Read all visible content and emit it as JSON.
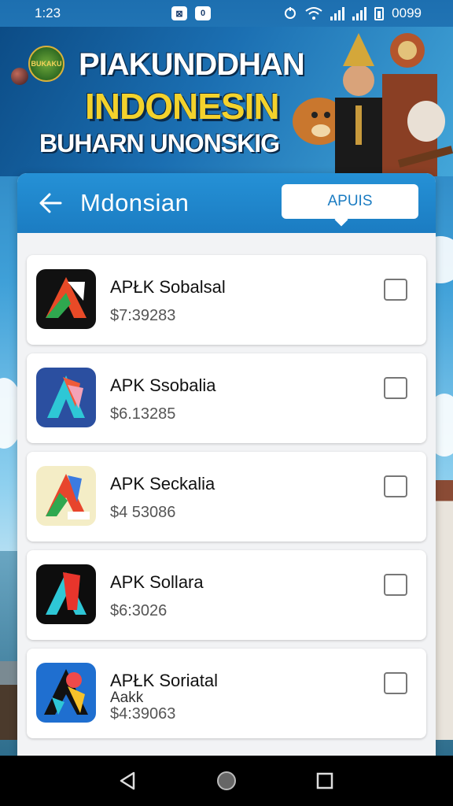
{
  "status_bar": {
    "time": "1:23",
    "notification": "0",
    "battery": "0099"
  },
  "banner": {
    "logo_text": "BUKAKU",
    "line1": "PIAKUNDDHAN",
    "line2": "INDONESIN",
    "line3": "BUHARN UNONSKIG"
  },
  "header": {
    "title": "Mdonsian",
    "action_label": "APUIS"
  },
  "apps": [
    {
      "name": "APŁK Sobalsal",
      "sub": "",
      "price": "$7:39283"
    },
    {
      "name": "APK Ssobalia",
      "sub": "",
      "price": "$6.13285"
    },
    {
      "name": "APK Seckalia",
      "sub": "",
      "price": "$4 53086"
    },
    {
      "name": "APK Sollara",
      "sub": "",
      "price": "$6:3026"
    },
    {
      "name": "APŁK Soriatal",
      "sub": "Aakk",
      "price": "$4:39063"
    }
  ],
  "colors": {
    "accent": "#1b7cc2",
    "banner_yellow": "#f3d22c"
  },
  "nav": {
    "back": "back-icon",
    "home": "home-icon",
    "recents": "recents-icon"
  }
}
